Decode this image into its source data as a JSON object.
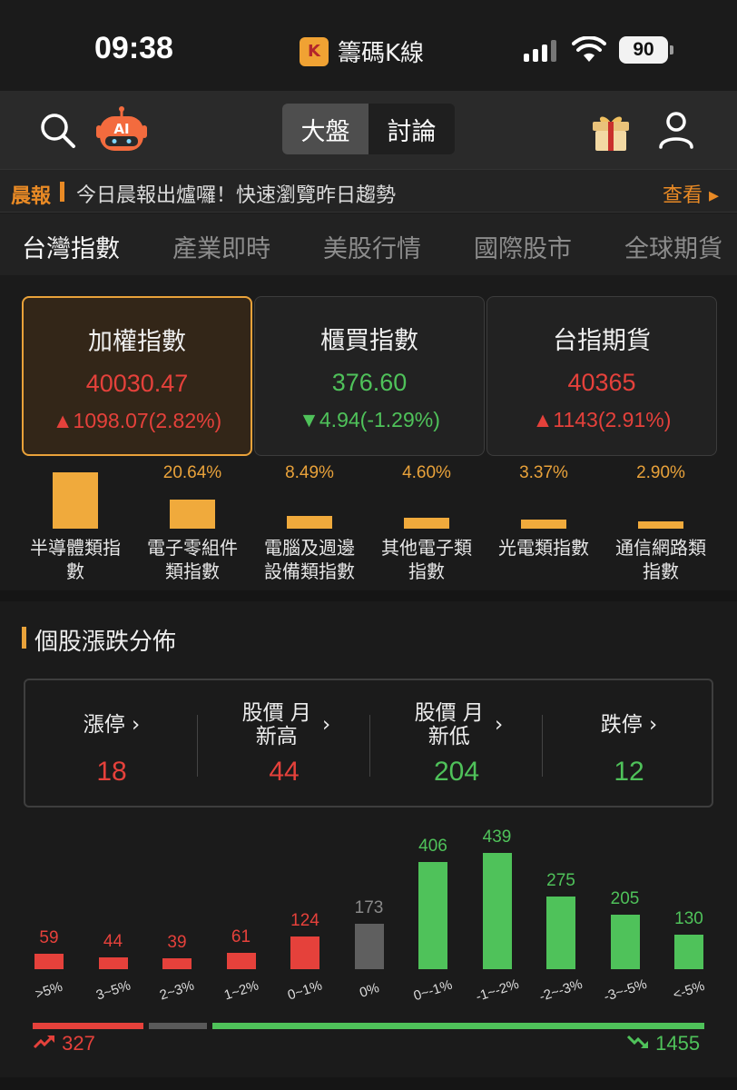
{
  "status": {
    "time": "09:38",
    "app_name": "籌碼K線",
    "battery": "90"
  },
  "header": {
    "seg_market": "大盤",
    "seg_discuss": "討論",
    "ai_badge": "AI"
  },
  "news": {
    "tag": "晨報",
    "text": "今日晨報出爐囉！快速瀏覽昨日趨勢",
    "more": "查看 ▸"
  },
  "tabs": [
    "台灣指數",
    "產業即時",
    "美股行情",
    "國際股市",
    "全球期貨"
  ],
  "indices": [
    {
      "title": "加權指數",
      "value": "40030.47",
      "change": "▲1098.07(2.82%)",
      "dir": "up"
    },
    {
      "title": "櫃買指數",
      "value": "376.60",
      "change": "▼4.94(-1.29%)",
      "dir": "down"
    },
    {
      "title": "台指期貨",
      "value": "40365",
      "change": "▲1143(2.91%)",
      "dir": "up"
    }
  ],
  "sectors": [
    {
      "name": "半導體類指數",
      "pct": "",
      "value": 100
    },
    {
      "name": "電子零組件類指數",
      "pct": "20.64%",
      "value": 20.64
    },
    {
      "name": "電腦及週邊設備類指數",
      "pct": "8.49%",
      "value": 8.49
    },
    {
      "name": "其他電子類指數",
      "pct": "4.60%",
      "value": 4.6
    },
    {
      "name": "光電類指數",
      "pct": "3.37%",
      "value": 3.37
    },
    {
      "name": "通信網路類指數",
      "pct": "2.90%",
      "value": 2.9
    }
  ],
  "distribution": {
    "section_title": "個股漲跌分佈",
    "summary": [
      {
        "label": "漲停",
        "value": "18",
        "dir": "up"
      },
      {
        "label": "股價 月新高",
        "value": "44",
        "dir": "up"
      },
      {
        "label": "股價 月新低",
        "value": "204",
        "dir": "down"
      },
      {
        "label": "跌停",
        "value": "12",
        "dir": "down"
      }
    ],
    "up_total": "327",
    "down_total": "1455",
    "colors": {
      "up": "#e5413b",
      "flat": "#5f5f5f",
      "down": "#4fc25a"
    }
  },
  "chart_data": {
    "type": "bar",
    "categories": [
      ">5%",
      "3~5%",
      "2~3%",
      "1~2%",
      "0~1%",
      "0%",
      "0~-1%",
      "-1~-2%",
      "-2~-3%",
      "-3~-5%",
      "<-5%"
    ],
    "values": [
      59,
      44,
      39,
      61,
      124,
      173,
      406,
      439,
      275,
      205,
      130
    ],
    "bar_kind": [
      "up",
      "up",
      "up",
      "up",
      "up",
      "flat",
      "down",
      "down",
      "down",
      "down",
      "down"
    ],
    "title": "",
    "xlabel": "",
    "ylabel": "",
    "grid": false
  }
}
